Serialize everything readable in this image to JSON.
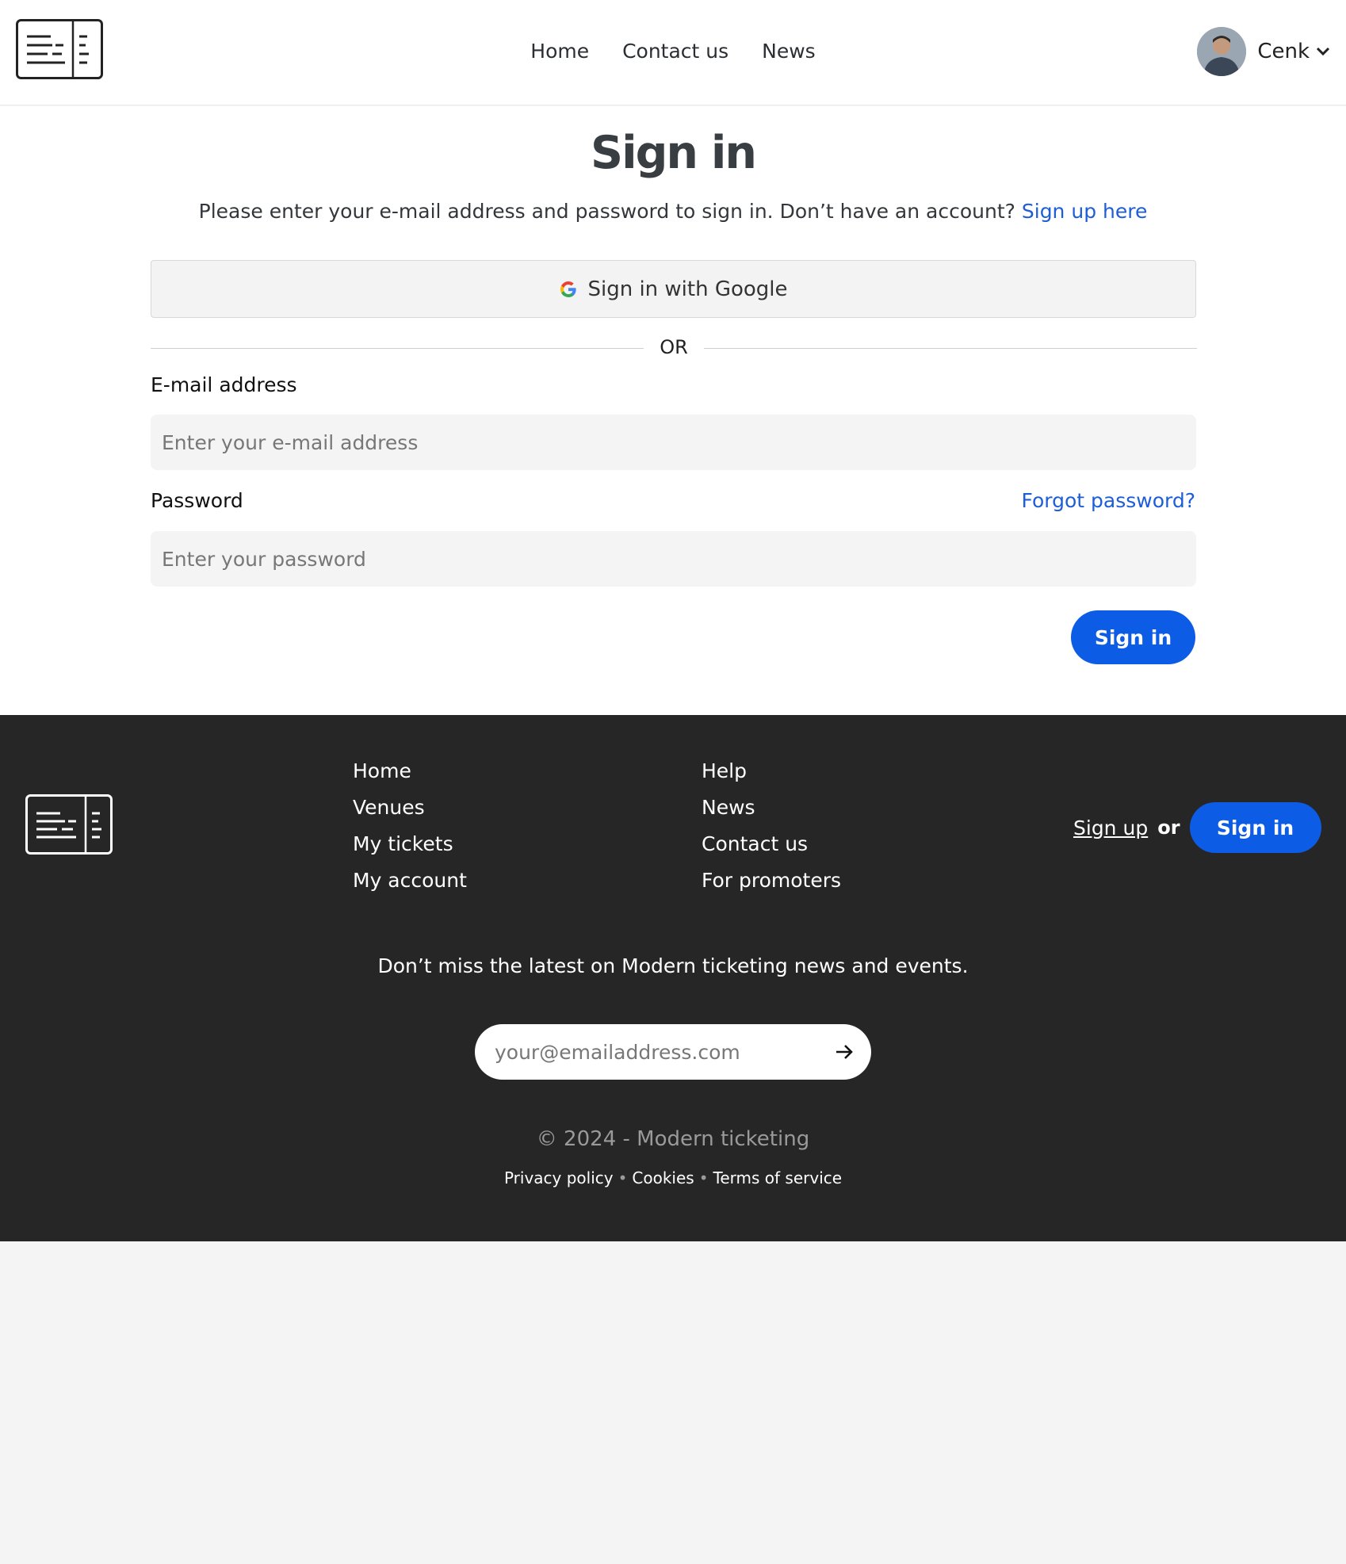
{
  "header": {
    "nav": [
      "Home",
      "Contact us",
      "News"
    ],
    "user_name": "Cenk"
  },
  "signin": {
    "title": "Sign in",
    "subtitle": "Please enter your e-mail address and password to sign in. Don’t have an account?",
    "signup_link": "Sign up here",
    "google_button": "Sign in with Google",
    "divider": "OR",
    "email_label": "E-mail address",
    "email_placeholder": "Enter your e-mail address",
    "password_label": "Password",
    "forgot": "Forgot password?",
    "password_placeholder": "Enter your password",
    "submit": "Sign in"
  },
  "footer": {
    "col1": [
      "Home",
      "Venues",
      "My tickets",
      "My account"
    ],
    "col2": [
      "Help",
      "News",
      "Contact us",
      "For promoters"
    ],
    "signup": "Sign up",
    "or": "or",
    "signin": "Sign in",
    "newsletter_text": "Don’t miss the latest on Modern ticketing news and events.",
    "newsletter_placeholder": "your@emailaddress.com",
    "copyright": "© 2024 - Modern ticketing",
    "legal": [
      "Privacy policy",
      "Cookies",
      "Terms of service"
    ]
  },
  "colors": {
    "accent": "#0d5ce6",
    "link": "#1d5ed8",
    "footer_bg": "#262626"
  },
  "icons": [
    "ticket-logo-icon",
    "chevron-down-icon",
    "google-icon",
    "arrow-right-icon"
  ]
}
